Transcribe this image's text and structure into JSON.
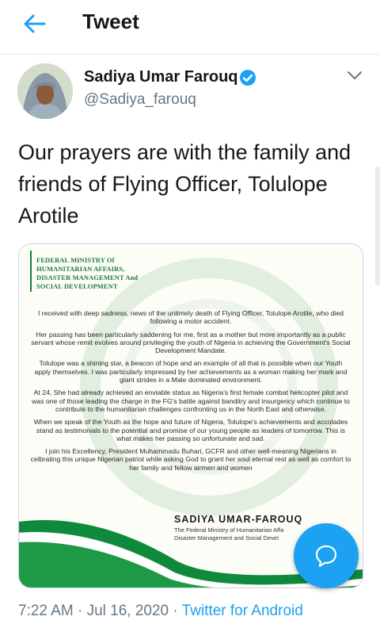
{
  "header": {
    "title": "Tweet"
  },
  "author": {
    "name": "Sadiya Umar Farouq",
    "handle": "@Sadiya_farouq"
  },
  "tweet": {
    "text": "Our prayers are with the family and friends of Flying Officer, Tolulope Arotile"
  },
  "media": {
    "letterhead": [
      "FEDERAL MINISTRY Of",
      "HUMANITARIAN AFFAIRS,",
      "DISASTER MANAGEMENT And",
      "SOCIAL DEVELOPMENT"
    ],
    "paragraphs": [
      "I received with deep sadness, news of the untimely death of Flying Officer, Tolulope Arotile, who died following a motor accident.",
      "Her passing has been particularly saddening for me, first as a mother but more importantly as a public servant whose remit evolves around privileging the youth of Nigeria in achieving the Government's Social Development Mandate.",
      "Tolulope was a shining star, a beacon of hope and an example of all that is possible when our Youth apply themselves. I was particularly impressed by her achievements as a woman making her mark and giant strides in a Male dominated environment.",
      "At 24, She had already achieved an enviable status as Nigeria's first female combat helicopter pilot and was one of those leading the charge in the FG's battle against banditry and insurgency which continue to contribute to the humanitarian challenges confronting us in the North East and otherwise.",
      "When we speak of the Youth as the hope and future of Nigeria, Tolulope's achievements and accolades stand as testimonials to the potential and promise of our young people as leaders of tomorrow. This is what makes her passing so unfortunate and sad.",
      "I join his Excellency, President Muhammadu Buhari, GCFR and other well-meaning Nigerians in celbrating this unique Nigerian patriot while asking God to grant her soul eternal rest as well as comfort to her family and fellow airmen and women"
    ],
    "signature_name": "SADIYA UMAR-FAROUQ",
    "signature_title": [
      "The Federal Ministry of Humanitarian Affa",
      "Disaster Management and Social Devel"
    ]
  },
  "footer": {
    "time": "7:22 AM · Jul 16, 2020 · ",
    "source": "Twitter for Android"
  },
  "colors": {
    "accent": "#1da1f2",
    "green": "#1d7a3a",
    "muted": "#657786"
  },
  "icons": {
    "back": "arrow-left-icon",
    "verified": "verified-badge-icon",
    "menu": "chevron-down-icon",
    "compose": "chat-bubble-icon"
  }
}
